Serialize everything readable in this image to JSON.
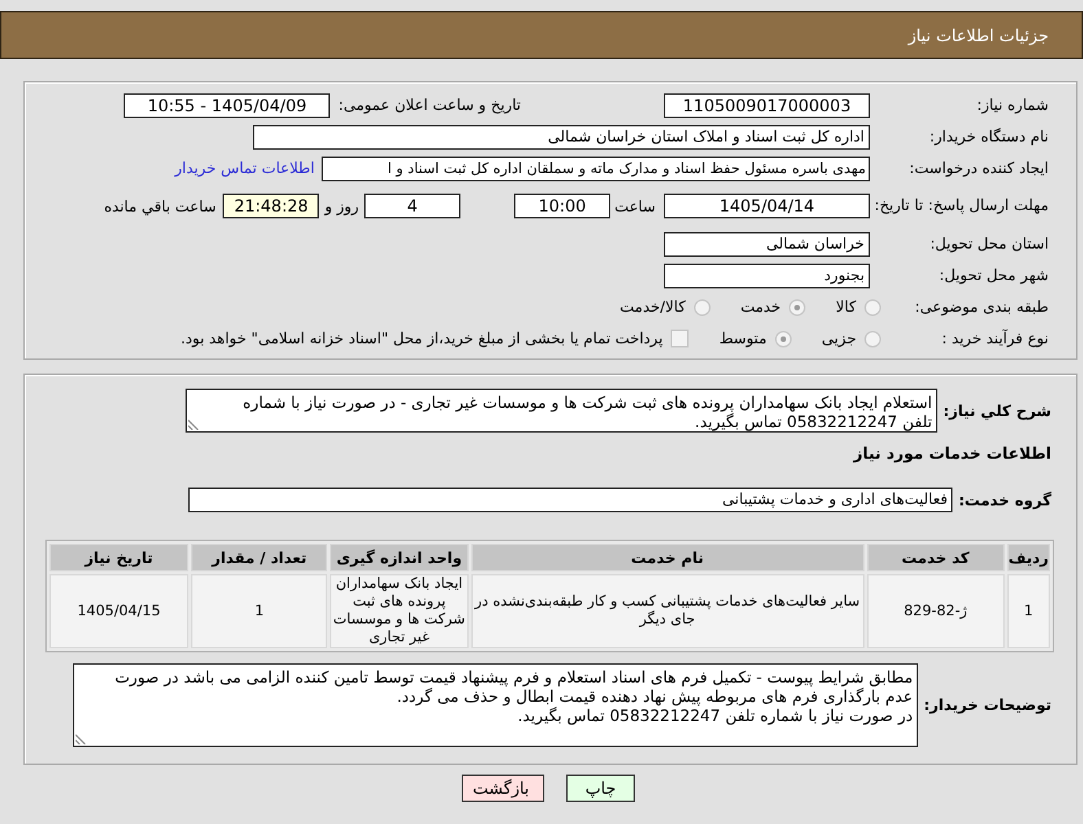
{
  "header": {
    "title": "جزئیات اطلاعات نیاز"
  },
  "details": {
    "need_number": {
      "label": "شماره نیاز:",
      "value": "1105009017000003"
    },
    "announce": {
      "label": "تاریخ و ساعت اعلان عمومی:",
      "value": "1405/04/09 - 10:55"
    },
    "buyer_org": {
      "label": "نام دستگاه خریدار:",
      "value": "اداره کل ثبت اسناد و املاک استان خراسان شمالی"
    },
    "requester": {
      "label": "ایجاد کننده درخواست:",
      "value": "مهدی باسره مسئول حفظ اسناد و مدارک ماته و سملقان اداره کل ثبت اسناد و ا",
      "contact_link": "اطلاعات تماس خریدار"
    },
    "deadline": {
      "label": "مهلت ارسال پاسخ: تا تاریخ:",
      "date": "1405/04/14",
      "time_label": "ساعت",
      "time": "10:00",
      "days": "4",
      "days_label": "روز و",
      "remaining": "21:48:28",
      "remaining_label": "ساعت باقي مانده"
    },
    "province": {
      "label": "استان محل تحویل:",
      "value": "خراسان شمالی"
    },
    "city": {
      "label": "شهر محل تحویل:",
      "value": "بجنورد"
    },
    "category": {
      "label": "طبقه بندی موضوعی:",
      "disabled": true,
      "options": [
        {
          "label": "کالا",
          "selected": false
        },
        {
          "label": "خدمت",
          "selected": true
        },
        {
          "label": "کالا/خدمت",
          "selected": false
        }
      ]
    },
    "process": {
      "label": "نوع فرآیند خرید :",
      "disabled": true,
      "options": [
        {
          "label": "جزیی",
          "selected": false
        },
        {
          "label": "متوسط",
          "selected": true
        }
      ],
      "treasury_option": {
        "label": "پرداخت تمام یا بخشی از مبلغ خرید،از محل \"اسناد خزانه اسلامی\" خواهد بود.",
        "checked": false
      }
    }
  },
  "summary": {
    "label": "شرح کلي نیاز:",
    "text": "استعلام ایجاد بانک سهامداران پرونده های ثبت شرکت ها و موسسات غیر تجاری - در صورت نیاز با شماره تلفن 05832212247 تماس بگیرید."
  },
  "services": {
    "title": "اطلاعات خدمات مورد نیاز",
    "group": {
      "label": "گروه خدمت:",
      "value": "فعالیت‌های اداری و خدمات پشتیبانی"
    },
    "table": {
      "columns": [
        "ردیف",
        "کد خدمت",
        "نام خدمت",
        "واحد اندازه گیری",
        "تعداد / مقدار",
        "تاریخ نیاز"
      ],
      "rows": [
        [
          "1",
          "ژ-82-829",
          "سایر فعالیت‌های خدمات پشتیبانی کسب و کار طبقه‌بندی‌نشده در جای دیگر",
          "ایجاد بانک سهامداران پرونده های ثبت شرکت ها و موسسات غیر تجاری",
          "1",
          "1405/04/15"
        ]
      ]
    }
  },
  "buyer_notes": {
    "label": "توضیحات خریدار:",
    "text": "مطابق شرایط پیوست - تکمیل فرم های اسناد استعلام و فرم پیشنهاد قیمت توسط تامین کننده الزامی می باشد در صورت عدم بارگذاری فرم های مربوطه پیش نهاد دهنده قیمت ابطال و حذف می گردد.\nدر صورت نیاز با شماره تلفن 05832212247 تماس بگیرید."
  },
  "buttons": [
    {
      "label": "چاپ",
      "kind": "print"
    },
    {
      "label": "بازگشت",
      "kind": "back"
    }
  ]
}
